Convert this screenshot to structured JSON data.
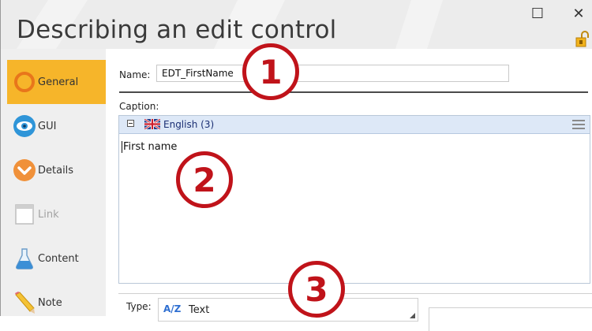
{
  "window": {
    "title": "Describing an edit control",
    "controls": {
      "maximize": "☐",
      "close": "✕"
    }
  },
  "sidebar": {
    "items": [
      {
        "label": "General",
        "icon": "general-ring-icon",
        "active": true,
        "enabled": true
      },
      {
        "label": "GUI",
        "icon": "eye-icon",
        "active": false,
        "enabled": true
      },
      {
        "label": "Details",
        "icon": "details-chevron-icon",
        "active": false,
        "enabled": true
      },
      {
        "label": "Link",
        "icon": "link-window-icon",
        "active": false,
        "enabled": false
      },
      {
        "label": "Content",
        "icon": "flask-icon",
        "active": false,
        "enabled": true
      },
      {
        "label": "Note",
        "icon": "pencil-icon",
        "active": false,
        "enabled": true
      }
    ]
  },
  "form": {
    "name_label": "Name:",
    "name_value": "EDT_FirstName",
    "caption_label": "Caption:",
    "language": "English (3)",
    "caption_text": "First name",
    "type_label": "Type:",
    "type_icon_text": "A/Z",
    "type_value": "Text"
  },
  "annotations": {
    "marker1": "1",
    "marker2": "2",
    "marker3": "3"
  },
  "colors": {
    "accent": "#f6b52a",
    "marker": "#c0131a",
    "sidebar_bg": "#efefef",
    "language_bar": "#dde8f7"
  }
}
